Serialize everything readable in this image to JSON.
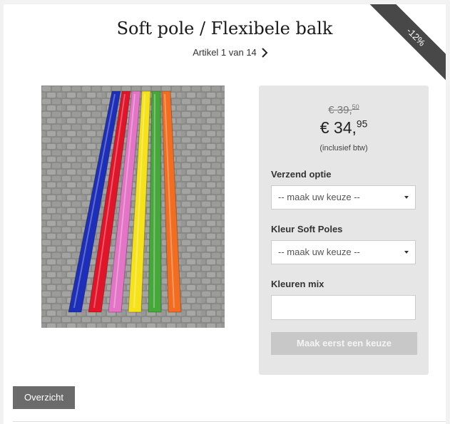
{
  "badge": {
    "discount": "-12%"
  },
  "product": {
    "title": "Soft pole / Flexibele balk"
  },
  "pager": {
    "text": "Artikel 1 van 14"
  },
  "price": {
    "old_main": "€ 39,",
    "old_cents": "50",
    "new_main": "€ 34,",
    "new_cents": "95",
    "vat_note": "(inclusief btw)"
  },
  "form": {
    "shipping_label": "Verzend optie",
    "shipping_value": "-- maak uw keuze --",
    "color_label": "Kleur Soft Poles",
    "color_value": "-- maak uw keuze --",
    "mix_label": "Kleuren mix",
    "mix_value": "",
    "submit_label": "Maak eerst een keuze"
  },
  "nav": {
    "overview_label": "Overzicht"
  },
  "colors": {
    "pole_colors": [
      "#1d2fb8",
      "#e0152a",
      "#e374c6",
      "#f5e21a",
      "#46a83a",
      "#f26d1f"
    ]
  }
}
